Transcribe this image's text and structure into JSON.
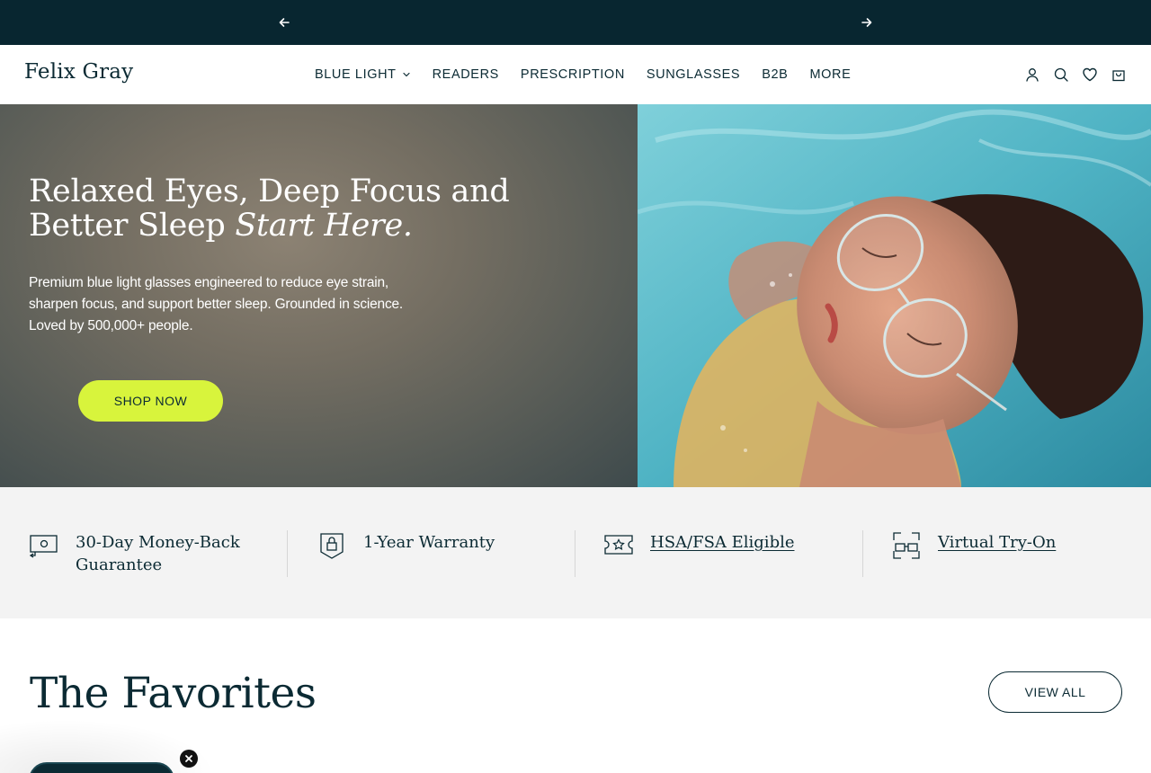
{
  "announcement": {
    "prev_icon": "arrow-left-icon",
    "next_icon": "arrow-right-icon"
  },
  "header": {
    "logo": "Felix Gray",
    "nav": [
      {
        "label": "BLUE LIGHT",
        "has_dropdown": true
      },
      {
        "label": "READERS"
      },
      {
        "label": "PRESCRIPTION"
      },
      {
        "label": "SUNGLASSES"
      },
      {
        "label": "B2B"
      },
      {
        "label": "MORE"
      }
    ],
    "icons": [
      "account-icon",
      "search-icon",
      "wishlist-heart-icon",
      "cart-bag-icon"
    ]
  },
  "hero": {
    "title_line": "Relaxed Eyes, Deep Focus and Better Sleep",
    "title_em": "Start Here.",
    "subtitle": "Premium blue light glasses engineered to reduce eye strain, sharpen focus, and support better sleep. Grounded in science. Loved by 500,000+ people.",
    "cta": "SHOP NOW"
  },
  "benefits": [
    {
      "icon": "money-back-icon",
      "label": "30-Day Money-Back Guarantee",
      "link": false
    },
    {
      "icon": "shield-lock-icon",
      "label": "1-Year Warranty",
      "link": false
    },
    {
      "icon": "hsa-ticket-star-icon",
      "label": "HSA/FSA Eligible",
      "link": true
    },
    {
      "icon": "virtual-try-on-icon",
      "label": "Virtual Try-On",
      "link": true
    }
  ],
  "favorites": {
    "title": "The Favorites",
    "view_all": "VIEW ALL"
  },
  "colors": {
    "navy": "#082630",
    "text": "#0b2a33",
    "cta_lime": "#d8f43c",
    "benefits_bg": "#f3f3f3"
  }
}
